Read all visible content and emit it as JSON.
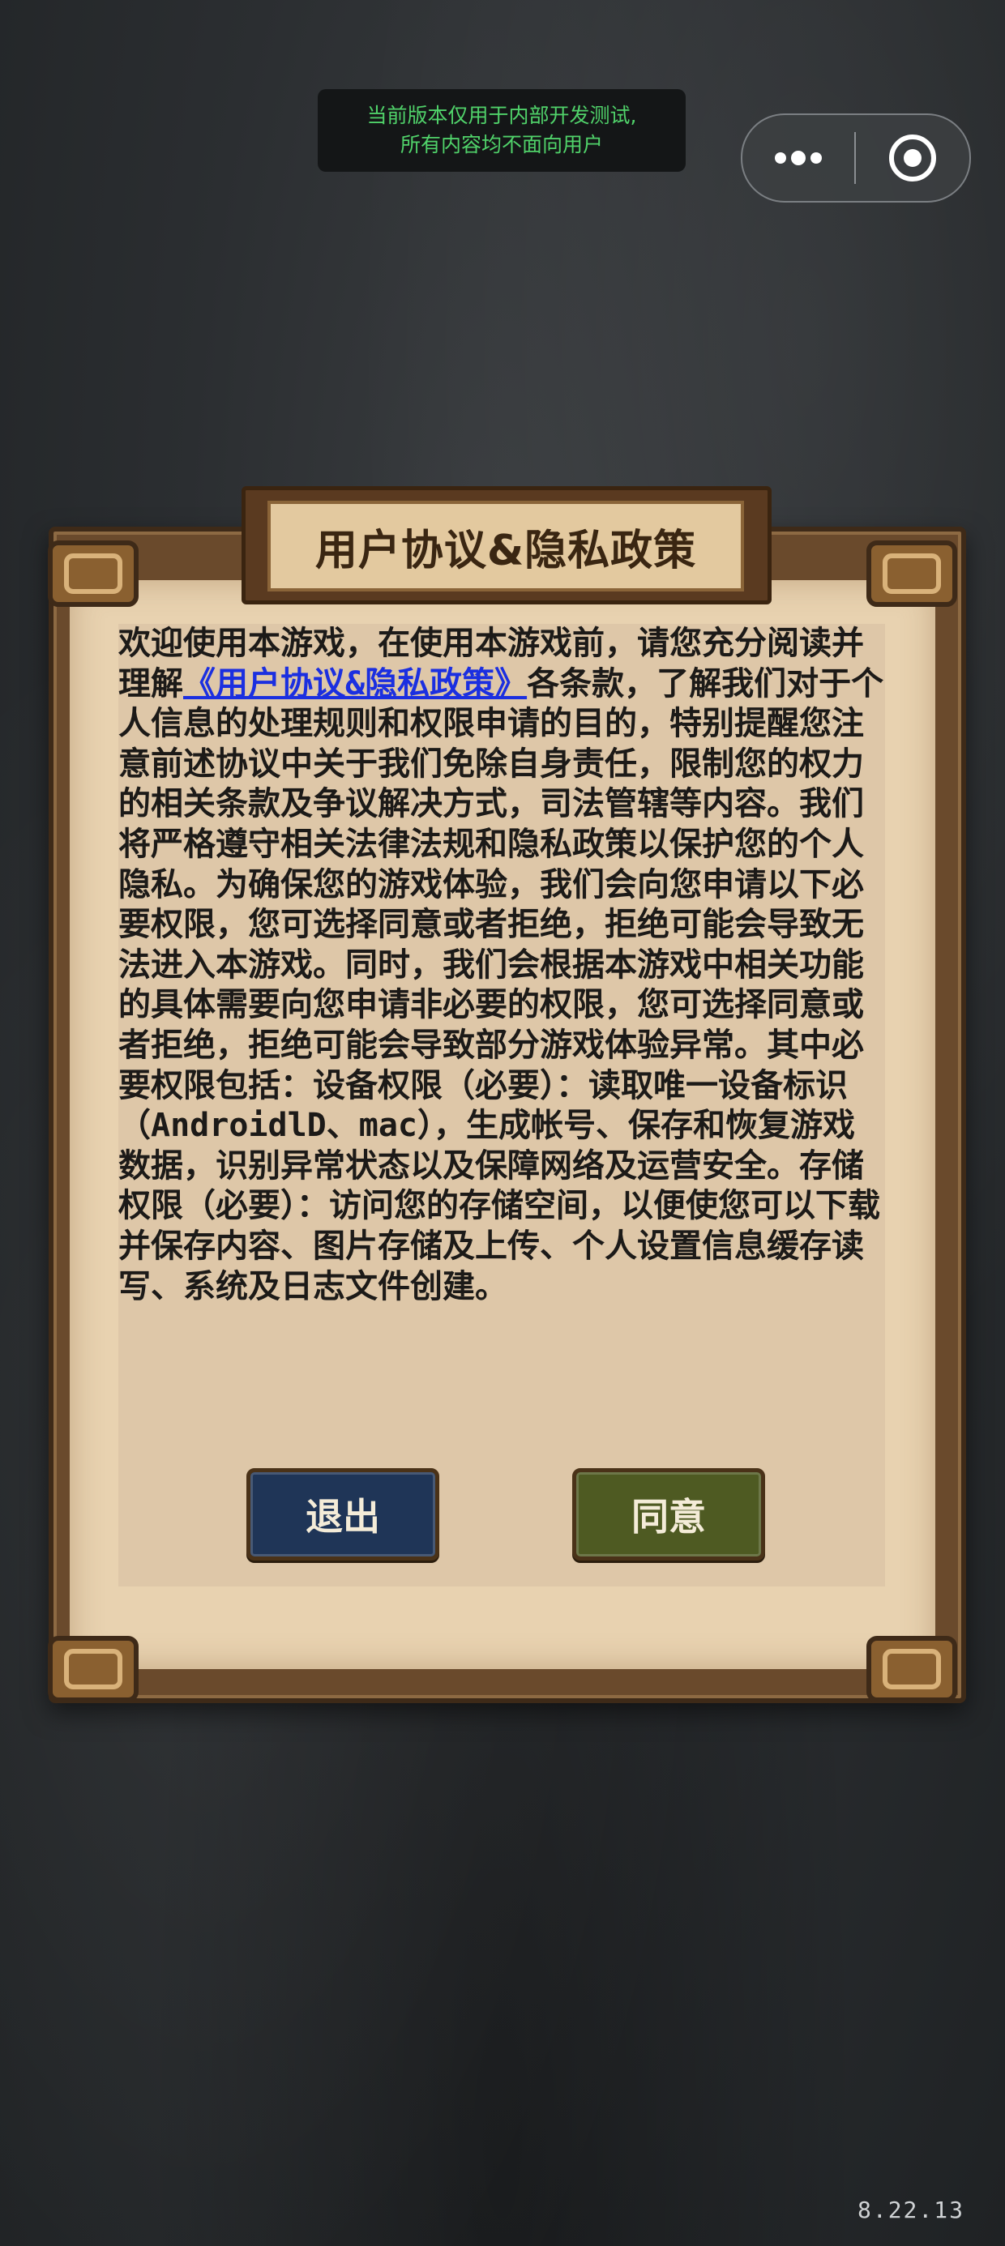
{
  "dev_banner": {
    "line1": "当前版本仅用于内部开发测试,",
    "line2": "所有内容均不面向用户"
  },
  "capsule": {
    "more_icon": "more-dots-icon",
    "close_icon": "target-close-icon"
  },
  "dialog": {
    "title": "用户协议&隐私政策",
    "body_intro": "欢迎使用本游戏，在使用本游戏前，请您充分阅读并理解",
    "link_text": "《用户协议&隐私政策》",
    "body_rest": "各条款，了解我们对于个人信息的处理规则和权限申请的目的，特别提醒您注意前述协议中关于我们免除自身责任，限制您的权力的相关条款及争议解决方式，司法管辖等内容。我们将严格遵守相关法律法规和隐私政策以保护您的个人隐私。为确保您的游戏体验，我们会向您申请以下必要权限，您可选择同意或者拒绝，拒绝可能会导致无法进入本游戏。同时，我们会根据本游戏中相关功能的具体需要向您申请非必要的权限，您可选择同意或者拒绝，拒绝可能会导致部分游戏体验异常。其中必要权限包括：设备权限（必要）：读取唯一设备标识（AndroidlD、mac），生成帐号、保存和恢复游戏数据，识别异常状态以及保障网络及运营安全。存储权限（必要）：访问您的存储空间，以便使您可以下载并保存内容、图片存储及上传、个人设置信息缓存读写、系统及日志文件创建。",
    "exit_label": "退出",
    "agree_label": "同意"
  },
  "version": "8.22.13",
  "colors": {
    "link": "#1b2fe0",
    "exit_button": "#1f3557",
    "agree_button": "#4e5a22",
    "banner_text": "#50d26a"
  }
}
